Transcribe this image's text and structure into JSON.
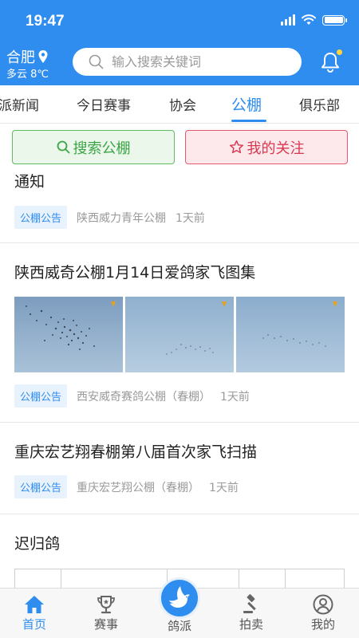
{
  "status_bar": {
    "time": "19:47"
  },
  "header": {
    "city": "合肥",
    "weather": "多云 8℃",
    "search_placeholder": "输入搜索关键词"
  },
  "tabs": [
    {
      "label": "派新闻"
    },
    {
      "label": "今日赛事"
    },
    {
      "label": "协会"
    },
    {
      "label": "公棚",
      "active": true
    },
    {
      "label": "俱乐部"
    }
  ],
  "actions": {
    "search_label": "搜索公棚",
    "follow_label": "我的关注"
  },
  "posts": [
    {
      "title": "通知",
      "tag": "公棚公告",
      "source": "陕西威力青年公棚",
      "time": "1天前"
    },
    {
      "title": "陕西威奇公棚1月14日爱鸽家飞图集",
      "tag": "公棚公告",
      "source": "西安威奇赛鸽公棚（春棚）",
      "time": "1天前"
    },
    {
      "title": "重庆宏艺翔春棚第八届首次家飞扫描",
      "tag": "公棚公告",
      "source": "重庆宏艺翔公棚（春棚）",
      "time": "1天前"
    },
    {
      "title": "迟归鸽"
    }
  ],
  "bottom_nav": [
    {
      "label": "首页",
      "icon": "home-icon",
      "active": true
    },
    {
      "label": "赛事",
      "icon": "trophy-icon"
    },
    {
      "label": "鸽派",
      "icon": "dove-icon"
    },
    {
      "label": "拍卖",
      "icon": "gavel-icon"
    },
    {
      "label": "我的",
      "icon": "user-icon"
    }
  ],
  "colors": {
    "brand": "#2f8df0",
    "search_button": "#3ba545",
    "follow_button": "#d8384f",
    "notification_dot": "#ffd43b"
  }
}
